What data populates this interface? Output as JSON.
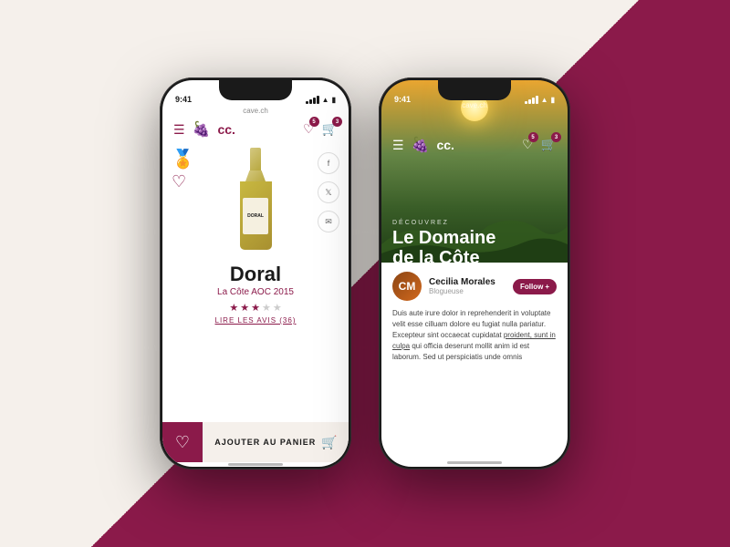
{
  "app": {
    "url": "cave.ch",
    "time": "9:41",
    "logo": "cc.",
    "heart_badge": "5",
    "cart_badge": "3"
  },
  "phone1": {
    "wine_name": "Doral",
    "wine_subtitle": "La Côte AOC 2015",
    "bottle_label": "DORAL",
    "stars_filled": 3,
    "stars_total": 5,
    "reviews_text": "LIRE LES AVIS (36)",
    "add_to_cart": "AJOUTER AU PANIER",
    "social_icons": [
      "f",
      "𝕏",
      "✉"
    ]
  },
  "phone2": {
    "discover_label": "DÉCOUVREZ",
    "domaine_title_line1": "Le Domaine",
    "domaine_title_line2": "de la Côte",
    "author_name": "Cecilia Morales",
    "author_role": "Blogueuse",
    "follow_label": "Follow",
    "follow_icon": "+",
    "article_text": "Duis aute irure dolor in reprehenderit in voluptate velit esse cilluam dolore eu fugiat nulla pariatur. Excepteur sint occaecat cupidatat proident, sunt in culpa qui officia deserunt mollit anim id est laborum. Sed ut perspiciatis unde omnis"
  }
}
